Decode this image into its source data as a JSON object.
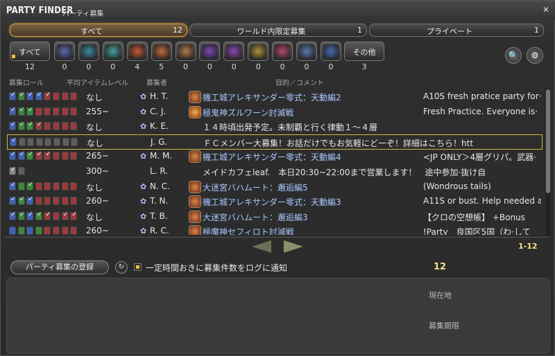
{
  "window": {
    "title": "PARTY FINDER",
    "subtitle": "パーティ募集",
    "close_glyph": "✕"
  },
  "tabs": [
    {
      "label": "すべて",
      "count": "12"
    },
    {
      "label": "ワールド内限定募集",
      "count": "1"
    },
    {
      "label": "プライベート",
      "count": "1"
    }
  ],
  "filters": {
    "all_label": "すべて",
    "all_count": "12",
    "categories": [
      {
        "icon": "question-icon",
        "count": "0",
        "color": "#5a6ab0"
      },
      {
        "icon": "dungeon-icon",
        "count": "0",
        "color": "#3e8aa0"
      },
      {
        "icon": "guildhest-icon",
        "count": "0",
        "color": "#4aa0a0"
      },
      {
        "icon": "trial-icon",
        "count": "4",
        "color": "#c05a3a"
      },
      {
        "icon": "raid-icon",
        "count": "5",
        "color": "#c06a3a"
      },
      {
        "icon": "pvp-icon",
        "count": "0",
        "color": "#b07a4a"
      },
      {
        "icon": "quest-icon",
        "count": "0",
        "color": "#7a4ab0"
      },
      {
        "icon": "fate-icon",
        "count": "0",
        "color": "#8a4ab0"
      },
      {
        "icon": "treasure-hunt-icon",
        "count": "0",
        "color": "#b0903a"
      },
      {
        "icon": "hunt-icon",
        "count": "0",
        "color": "#b04a6a"
      },
      {
        "icon": "gathering-icon",
        "count": "0",
        "color": "#5a7ab0"
      },
      {
        "icon": "deep-dungeon-icon",
        "count": "0",
        "color": "#4a6ab0"
      }
    ],
    "other_label": "その他",
    "other_count": "3"
  },
  "tools": {
    "search_icon": "🔍",
    "settings_icon": "⚙"
  },
  "columns": {
    "role": "募集ロール",
    "ilvl": "平均アイテムレベル",
    "recruiter": "募集者",
    "duty": "目的／コメント"
  },
  "rows": [
    {
      "roles": [
        "tc",
        "hc",
        "tc",
        "tc",
        "dc",
        "d",
        "d",
        "d"
      ],
      "ilvl": "なし",
      "job": "✿",
      "recruiter": "H. T.",
      "icon": "raid",
      "duty": "機工城アレキサンダー零式：天動編2",
      "comment": "A10S fresh pratice party for·",
      "selected": false
    },
    {
      "roles": [
        "tc",
        "hc",
        "hc",
        "d",
        "d",
        "d",
        "d",
        "d"
      ],
      "ilvl": "255~",
      "job": "✿",
      "recruiter": "C. J.",
      "icon": "trial",
      "duty": "極鬼神ズルワーン討滅戦",
      "comment": "Fresh Practice. Everyone is·",
      "selected": false
    },
    {
      "roles": [
        "tc",
        "hc",
        "hc",
        "dc",
        "d",
        "d",
        "d",
        "d"
      ],
      "ilvl": "なし",
      "job": "✿",
      "recruiter": "K. E.",
      "icon": "",
      "duty": "１４時頃出発予定。未制覇と行く律動１～４層",
      "comment": "",
      "selected": false
    },
    {
      "roles": [
        "tc",
        "g",
        "g",
        "g",
        "g",
        "g",
        "g",
        "g"
      ],
      "ilvl": "なし",
      "job": "",
      "recruiter": "J. G.",
      "icon": "",
      "duty": "ＦＣメンバー大募集！お話だけでもお気軽にどーぞ！詳細はこちら！htt",
      "comment": "",
      "selected": true
    },
    {
      "roles": [
        "tc",
        "tc",
        "hc",
        "dc",
        "dc",
        "d",
        "d",
        "d"
      ],
      "ilvl": "265~",
      "job": "✿",
      "recruiter": "M. M.",
      "icon": "raid",
      "duty": "機工城アレキサンダー零式：天動編4",
      "comment": "<JP ONLY＞4層グリパ。武器·",
      "selected": false
    },
    {
      "roles": [
        "ec",
        "g"
      ],
      "ilvl": "300~",
      "job": "",
      "recruiter": "L. R.",
      "icon": "",
      "duty": "メイドカフェleaf.　本日20:30~22:00まで営業します！　途中参加·抜け自",
      "comment": "",
      "selected": false
    },
    {
      "roles": [
        "tc",
        "h",
        "hc",
        "d",
        "d",
        "d",
        "d",
        "d"
      ],
      "ilvl": "なし",
      "job": "✿",
      "recruiter": "N. C.",
      "icon": "raid",
      "duty": "大迷宮バハムート：邂逅編5",
      "comment": "(Wondrous tails)",
      "selected": false
    },
    {
      "roles": [
        "tc",
        "hc",
        "tc",
        "d",
        "d",
        "d",
        "d",
        "d"
      ],
      "ilvl": "260~",
      "job": "✿",
      "recruiter": "T. N.",
      "icon": "raid",
      "duty": "機工城アレキサンダー零式：天動編3",
      "comment": "A11S or bust. Help needed a·",
      "selected": false
    },
    {
      "roles": [
        "tc",
        "hc",
        "tc",
        "hc",
        "dc",
        "d",
        "dc",
        "dc"
      ],
      "ilvl": "なし",
      "job": "✿",
      "recruiter": "T. B.",
      "icon": "raid",
      "duty": "大迷宮バハムート：邂逅編3",
      "comment": "【クロの空想帳】 +Bonus",
      "selected": false
    },
    {
      "roles": [
        "t",
        "h",
        "t",
        "h",
        "d",
        "d",
        "d",
        "d"
      ],
      "ilvl": "260~",
      "job": "✿",
      "recruiter": "R. C.",
      "icon": "raid",
      "duty": "極魔神セフィロト討滅戦",
      "comment": "!Party　良国区5国（わ·して",
      "selected": false
    }
  ],
  "pager": {
    "range": "1-12"
  },
  "footer": {
    "register_label": "パーティ募集の登録",
    "refresh_icon": "↻",
    "notify_label": "一定時間おきに募集件数をログに通知",
    "notify_count": "12"
  },
  "detail": {
    "location_label": "現在地",
    "deadline_label": "募集期限"
  }
}
